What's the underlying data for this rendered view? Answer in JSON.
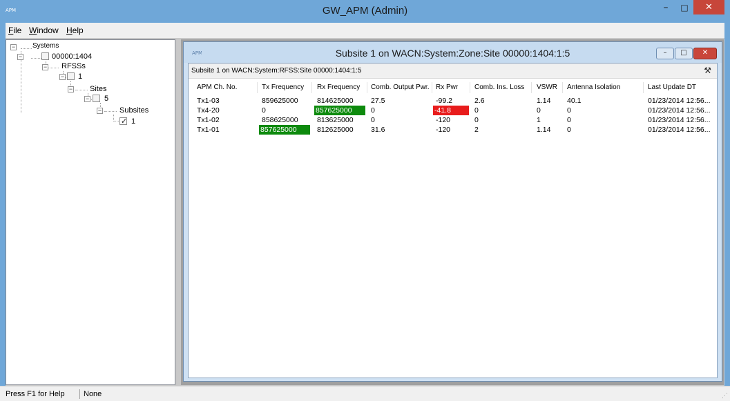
{
  "window": {
    "title": "GW_APM (Admin)",
    "app_icon": "apm-icon",
    "minimize_glyph": "–",
    "maximize_glyph": "□",
    "close_glyph": "✕"
  },
  "menu": {
    "items": [
      {
        "label": "File",
        "mnemonic": "F",
        "rest": "ile"
      },
      {
        "label": "Window",
        "mnemonic": "W",
        "rest": "indow"
      },
      {
        "label": "Help",
        "mnemonic": "H",
        "rest": "elp"
      }
    ]
  },
  "tree": {
    "systems": "Systems",
    "system_id": "00000:1404",
    "rfss": "RFSSs",
    "rfss_id": "1",
    "sites": "Sites",
    "site_id": "5",
    "subsites": "Subsites",
    "subsite_id": "1",
    "expander_glyph": "−"
  },
  "child": {
    "title": "Subsite 1 on WACN:System:Zone:Site 00000:1404:1:5",
    "subheader": "Subsite 1 on WACN:System:RFSS:Site 00000:1404:1:5",
    "tools_icon": "⚒",
    "min_glyph": "–",
    "max_glyph": "□",
    "close_glyph": "✕"
  },
  "grid": {
    "columns": [
      "APM Ch. No.",
      "Tx Frequency",
      "Rx Frequency",
      "Comb. Output Pwr.",
      "Rx Pwr",
      "Comb. Ins. Loss",
      "VSWR",
      "Antenna Isolation",
      "Last Update DT"
    ],
    "rows": [
      [
        "Tx1-03",
        "859625000",
        "814625000",
        "27.5",
        "-99.2",
        "2.6",
        "1.14",
        "40.1",
        "01/23/2014 12:56..."
      ],
      [
        "Tx4-20",
        "0",
        "857625000",
        "0",
        "-41.8",
        "0",
        "0",
        "0",
        "01/23/2014 12:56..."
      ],
      [
        "Tx1-02",
        "858625000",
        "813625000",
        "0",
        "-120",
        "0",
        "1",
        "0",
        "01/23/2014 12:56..."
      ],
      [
        "Tx1-01",
        "857625000",
        "812625000",
        "31.6",
        "-120",
        "2",
        "1.14",
        "0",
        "01/23/2014 12:56..."
      ]
    ],
    "highlights": {
      "green": "#0d8a0d",
      "red": "#e81c1c"
    }
  },
  "status": {
    "help": "Press F1 for Help",
    "state": "None",
    "grip": "⋰"
  }
}
